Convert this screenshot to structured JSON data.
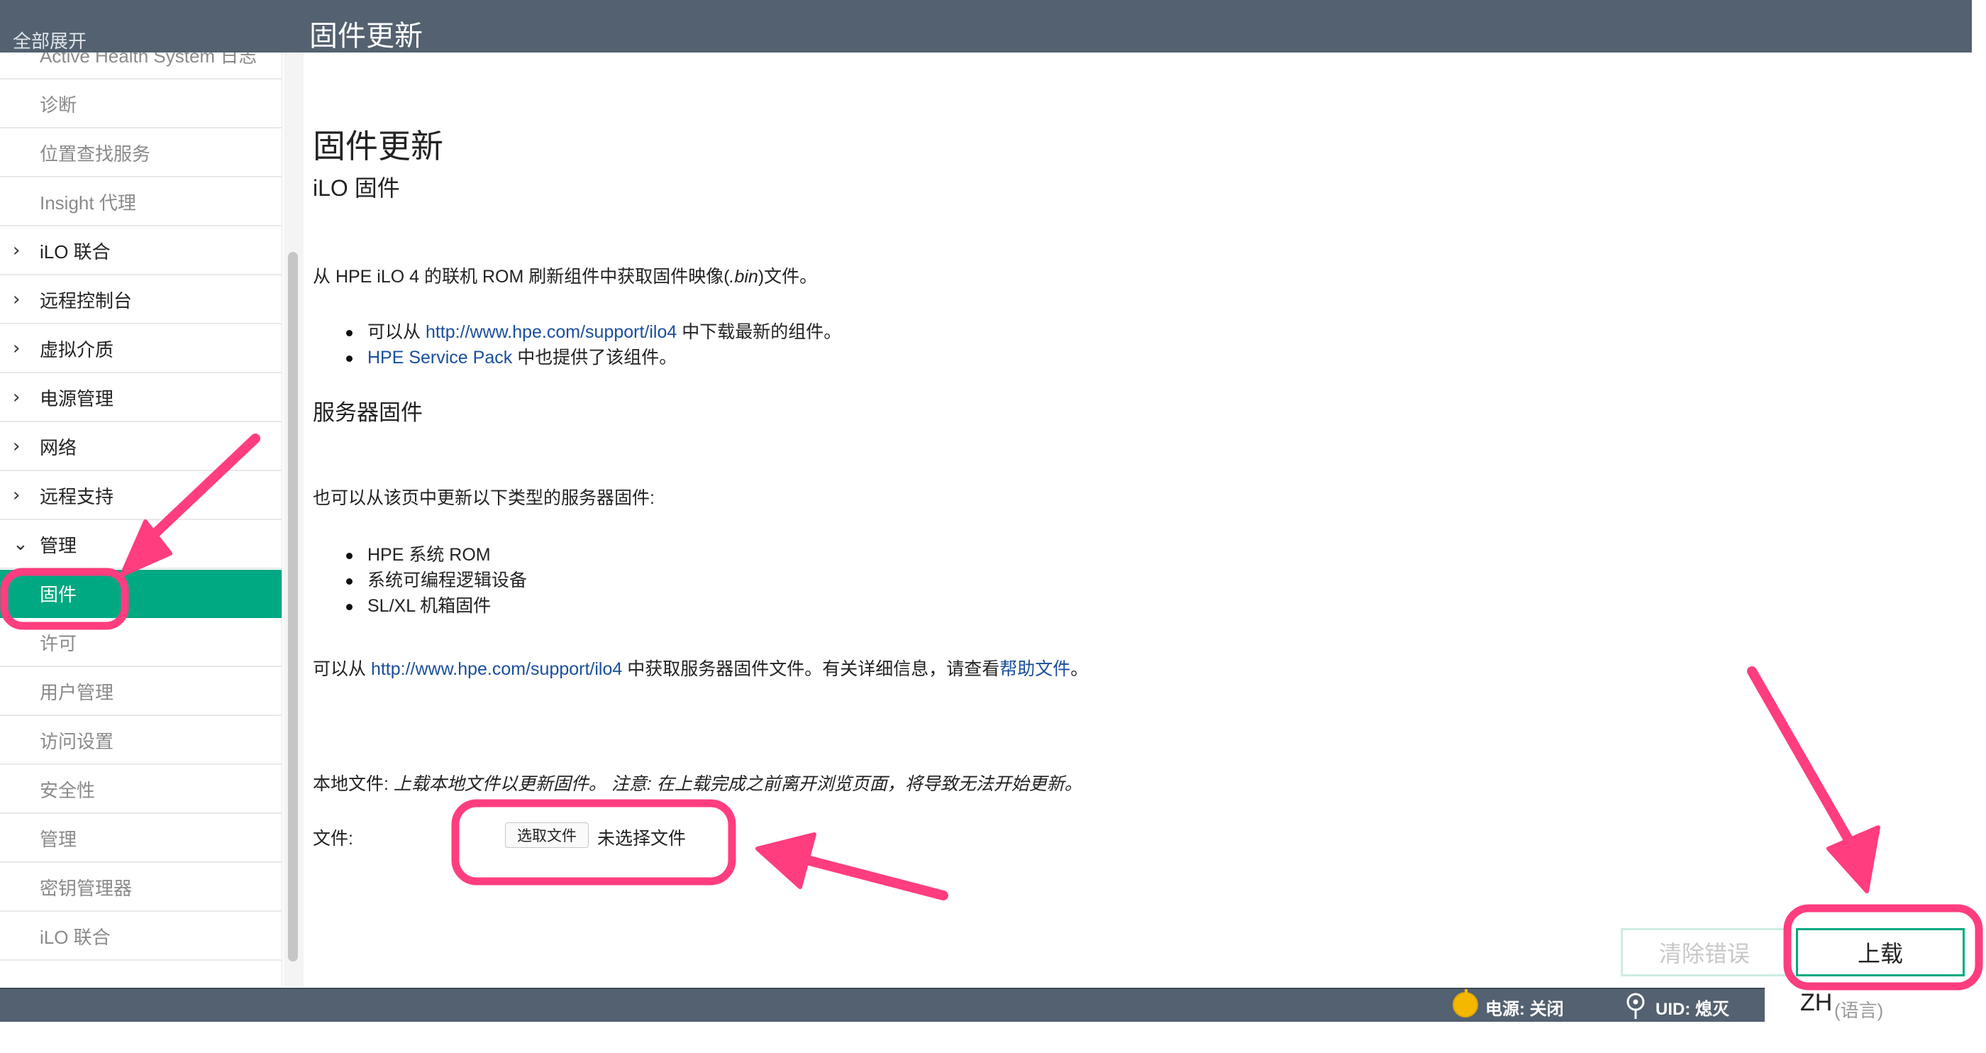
{
  "header": {
    "expand_all": "全部展开",
    "page_title": "固件更新"
  },
  "sidebar": {
    "items": [
      {
        "label": "Active Health System 日志",
        "kind": "sub",
        "chevron": ""
      },
      {
        "label": "诊断",
        "kind": "sub",
        "chevron": ""
      },
      {
        "label": "位置查找服务",
        "kind": "sub",
        "chevron": ""
      },
      {
        "label": "Insight 代理",
        "kind": "sub",
        "chevron": ""
      },
      {
        "label": "iLO 联合",
        "kind": "top",
        "chevron": "›"
      },
      {
        "label": "远程控制台",
        "kind": "top",
        "chevron": "›"
      },
      {
        "label": "虚拟介质",
        "kind": "top",
        "chevron": "›"
      },
      {
        "label": "电源管理",
        "kind": "top",
        "chevron": "›"
      },
      {
        "label": "网络",
        "kind": "top",
        "chevron": "›"
      },
      {
        "label": "远程支持",
        "kind": "top",
        "chevron": "›"
      },
      {
        "label": "管理",
        "kind": "top",
        "chevron": "⌄"
      },
      {
        "label": "固件",
        "kind": "active",
        "chevron": ""
      },
      {
        "label": "许可",
        "kind": "sub",
        "chevron": ""
      },
      {
        "label": "用户管理",
        "kind": "sub",
        "chevron": ""
      },
      {
        "label": "访问设置",
        "kind": "sub",
        "chevron": ""
      },
      {
        "label": "安全性",
        "kind": "sub",
        "chevron": ""
      },
      {
        "label": "管理",
        "kind": "sub",
        "chevron": ""
      },
      {
        "label": "密钥管理器",
        "kind": "sub",
        "chevron": ""
      },
      {
        "label": "iLO 联合",
        "kind": "sub",
        "chevron": ""
      }
    ]
  },
  "main": {
    "title": "固件更新",
    "ilo_heading": "iLO 固件",
    "intro_pre": "从 HPE iLO 4 的联机 ROM 刷新组件中获取固件映像(",
    "intro_ext": ".bin",
    "intro_post": ")文件。",
    "bullet1_pre": "可以从 ",
    "bullet1_link": "http://www.hpe.com/support/ilo4",
    "bullet1_post": " 中下载最新的组件。",
    "bullet2_link": "HPE Service Pack",
    "bullet2_post": " 中也提供了该组件。",
    "server_heading": "服务器固件",
    "server_intro": "也可以从该页中更新以下类型的服务器固件:",
    "server_types": [
      "HPE 系统 ROM",
      "系统可编程逻辑设备",
      "SL/XL 机箱固件"
    ],
    "get_pre": "可以从 ",
    "get_link": "http://www.hpe.com/support/ilo4",
    "get_mid": " 中获取服务器固件文件。有关详细信息，请查看",
    "get_help_link": "帮助文件",
    "get_end": "。",
    "local_label": "本地文件: ",
    "local_italic": "上载本地文件以更新固件。 注意: 在上载完成之前离开浏览页面，将导致无法开始更新。",
    "file_label": "文件:",
    "choose_file": "选取文件",
    "no_file": "未选择文件",
    "clear_errors": "清除错误",
    "upload": "上载"
  },
  "status": {
    "power": "电源: 关闭",
    "uid": "UID: 熄灭",
    "lang_code": "ZH",
    "lang_hint": "(语言)"
  },
  "colors": {
    "header_bg": "#536170",
    "accent": "#01a982",
    "link": "#1a4f9c",
    "annotation": "#ff3d7f"
  }
}
